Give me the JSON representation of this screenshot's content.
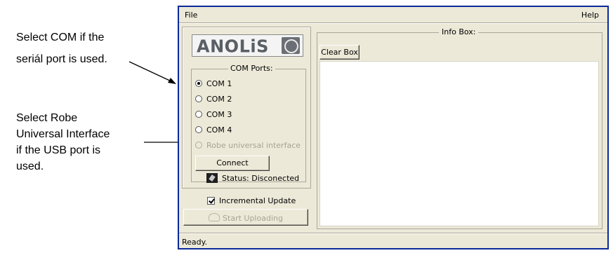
{
  "annotations": {
    "com_note": [
      "Select COM if the",
      "seriál port is used."
    ],
    "usb_note": [
      "Select Robe",
      "Universal Interface",
      "if the USB port is",
      "used."
    ]
  },
  "menu": {
    "file": "File",
    "help": "Help"
  },
  "logo": {
    "text": "ANOLiS"
  },
  "com_ports": {
    "title": "COM Ports:",
    "options": [
      {
        "label": "COM 1",
        "checked": true,
        "enabled": true
      },
      {
        "label": "COM 2",
        "checked": false,
        "enabled": true
      },
      {
        "label": "COM 3",
        "checked": false,
        "enabled": true
      },
      {
        "label": "COM 4",
        "checked": false,
        "enabled": true
      },
      {
        "label": "Robe universal interface",
        "checked": false,
        "enabled": false
      }
    ]
  },
  "connect_button": "Connect",
  "status": "Status: Disconected",
  "incremental_update": {
    "label": "Incremental Update",
    "checked": true
  },
  "upload_button": "Start Uploading",
  "info_box": {
    "title": "Info Box:",
    "clear_button": "Clear Box"
  },
  "statusbar": "Ready."
}
